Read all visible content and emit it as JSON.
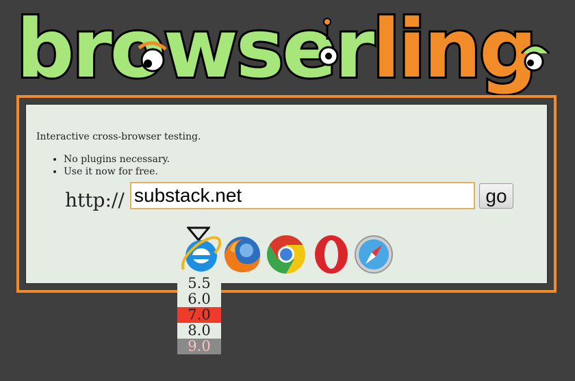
{
  "brand": {
    "part1": "browser",
    "part2": "ling",
    "color1": "#a6e67a",
    "color2": "#f28c28",
    "outline": "#000000"
  },
  "page": {
    "background": "#3f3f3f",
    "panel_border": "#f28c28",
    "panel_bg": "#e4ece4"
  },
  "intro": {
    "tagline": "Interactive cross-browser testing.",
    "features": [
      "No plugins necessary.",
      "Use it now for free."
    ]
  },
  "form": {
    "url_prefix": "http://",
    "url_value": "substack.net",
    "go_label": "go"
  },
  "browsers": {
    "selected_version": "9.0",
    "items": [
      {
        "name": "internet-explorer",
        "icon": "ie-icon"
      },
      {
        "name": "firefox",
        "icon": "firefox-icon"
      },
      {
        "name": "chrome",
        "icon": "chrome-icon"
      },
      {
        "name": "opera",
        "icon": "opera-icon"
      },
      {
        "name": "safari",
        "icon": "safari-icon"
      }
    ],
    "versions": [
      {
        "label": "5.5",
        "bg": "#e4ece4"
      },
      {
        "label": "6.0",
        "bg": "#e4ece4"
      },
      {
        "label": "7.0",
        "bg": "#f03a2a"
      },
      {
        "label": "8.0",
        "bg": "#e4ece4"
      },
      {
        "label": "9.0",
        "bg": "#8a8a8a"
      }
    ]
  }
}
